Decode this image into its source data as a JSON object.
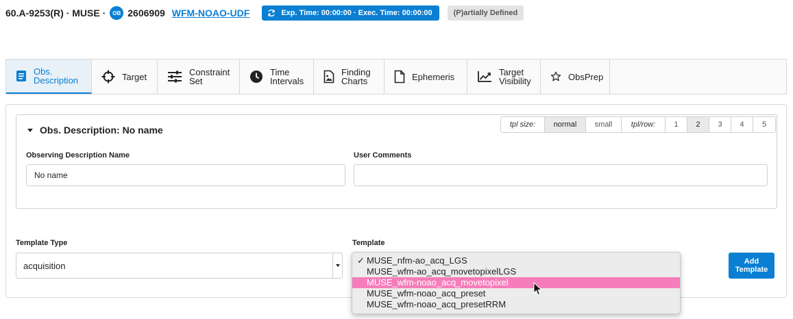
{
  "header": {
    "program": "60.A-9253(R) · MUSE ·",
    "ob_badge": "OB",
    "ob_id": "2606909",
    "ob_name": "WFM-NOAO-UDF",
    "exposure": "Exp. Time: 00:00:00 · Exec. Time: 00:00:00",
    "status": "(P)artially Defined"
  },
  "tabs": [
    {
      "label": "Obs. Description",
      "icon": "document-icon",
      "active": true
    },
    {
      "label": "Target",
      "icon": "crosshair-icon"
    },
    {
      "label": "Constraint Set",
      "icon": "sliders-icon"
    },
    {
      "label": "Time Intervals",
      "icon": "clock-icon"
    },
    {
      "label": "Finding Charts",
      "icon": "image-file-icon"
    },
    {
      "label": "Ephemeris",
      "icon": "file-icon"
    },
    {
      "label": "Target Visibility",
      "icon": "line-chart-icon"
    },
    {
      "label": "ObsPrep",
      "icon": "star-icon"
    }
  ],
  "obs_description": {
    "title": "Obs. Description: No name",
    "tpl_size_label": "tpl size:",
    "tpl_sizes": [
      "normal",
      "small"
    ],
    "tpl_size_selected": "normal",
    "tpl_row_label": "tpl/row:",
    "tpl_rows": [
      "1",
      "2",
      "3",
      "4",
      "5"
    ],
    "tpl_row_selected": "2",
    "name_label": "Observing Description Name",
    "name_value": "No name",
    "comments_label": "User Comments",
    "comments_value": ""
  },
  "template": {
    "type_label": "Template Type",
    "type_value": "acquisition",
    "template_label": "Template",
    "options": [
      "MUSE_nfm-ao_acq_LGS",
      "MUSE_wfm-ao_acq_movetopixelLGS",
      "MUSE_wfm-noao_acq_movetopixel",
      "MUSE_wfm-noao_acq_preset",
      "MUSE_wfm-noao_acq_presetRRM"
    ],
    "checked_index": 0,
    "highlighted_index": 2,
    "check_mark": "✓",
    "add_button": "Add Template"
  },
  "colors": {
    "accent": "#0a7fd3",
    "highlight": "#f57dba",
    "status_bg": "#e3e3e3"
  }
}
